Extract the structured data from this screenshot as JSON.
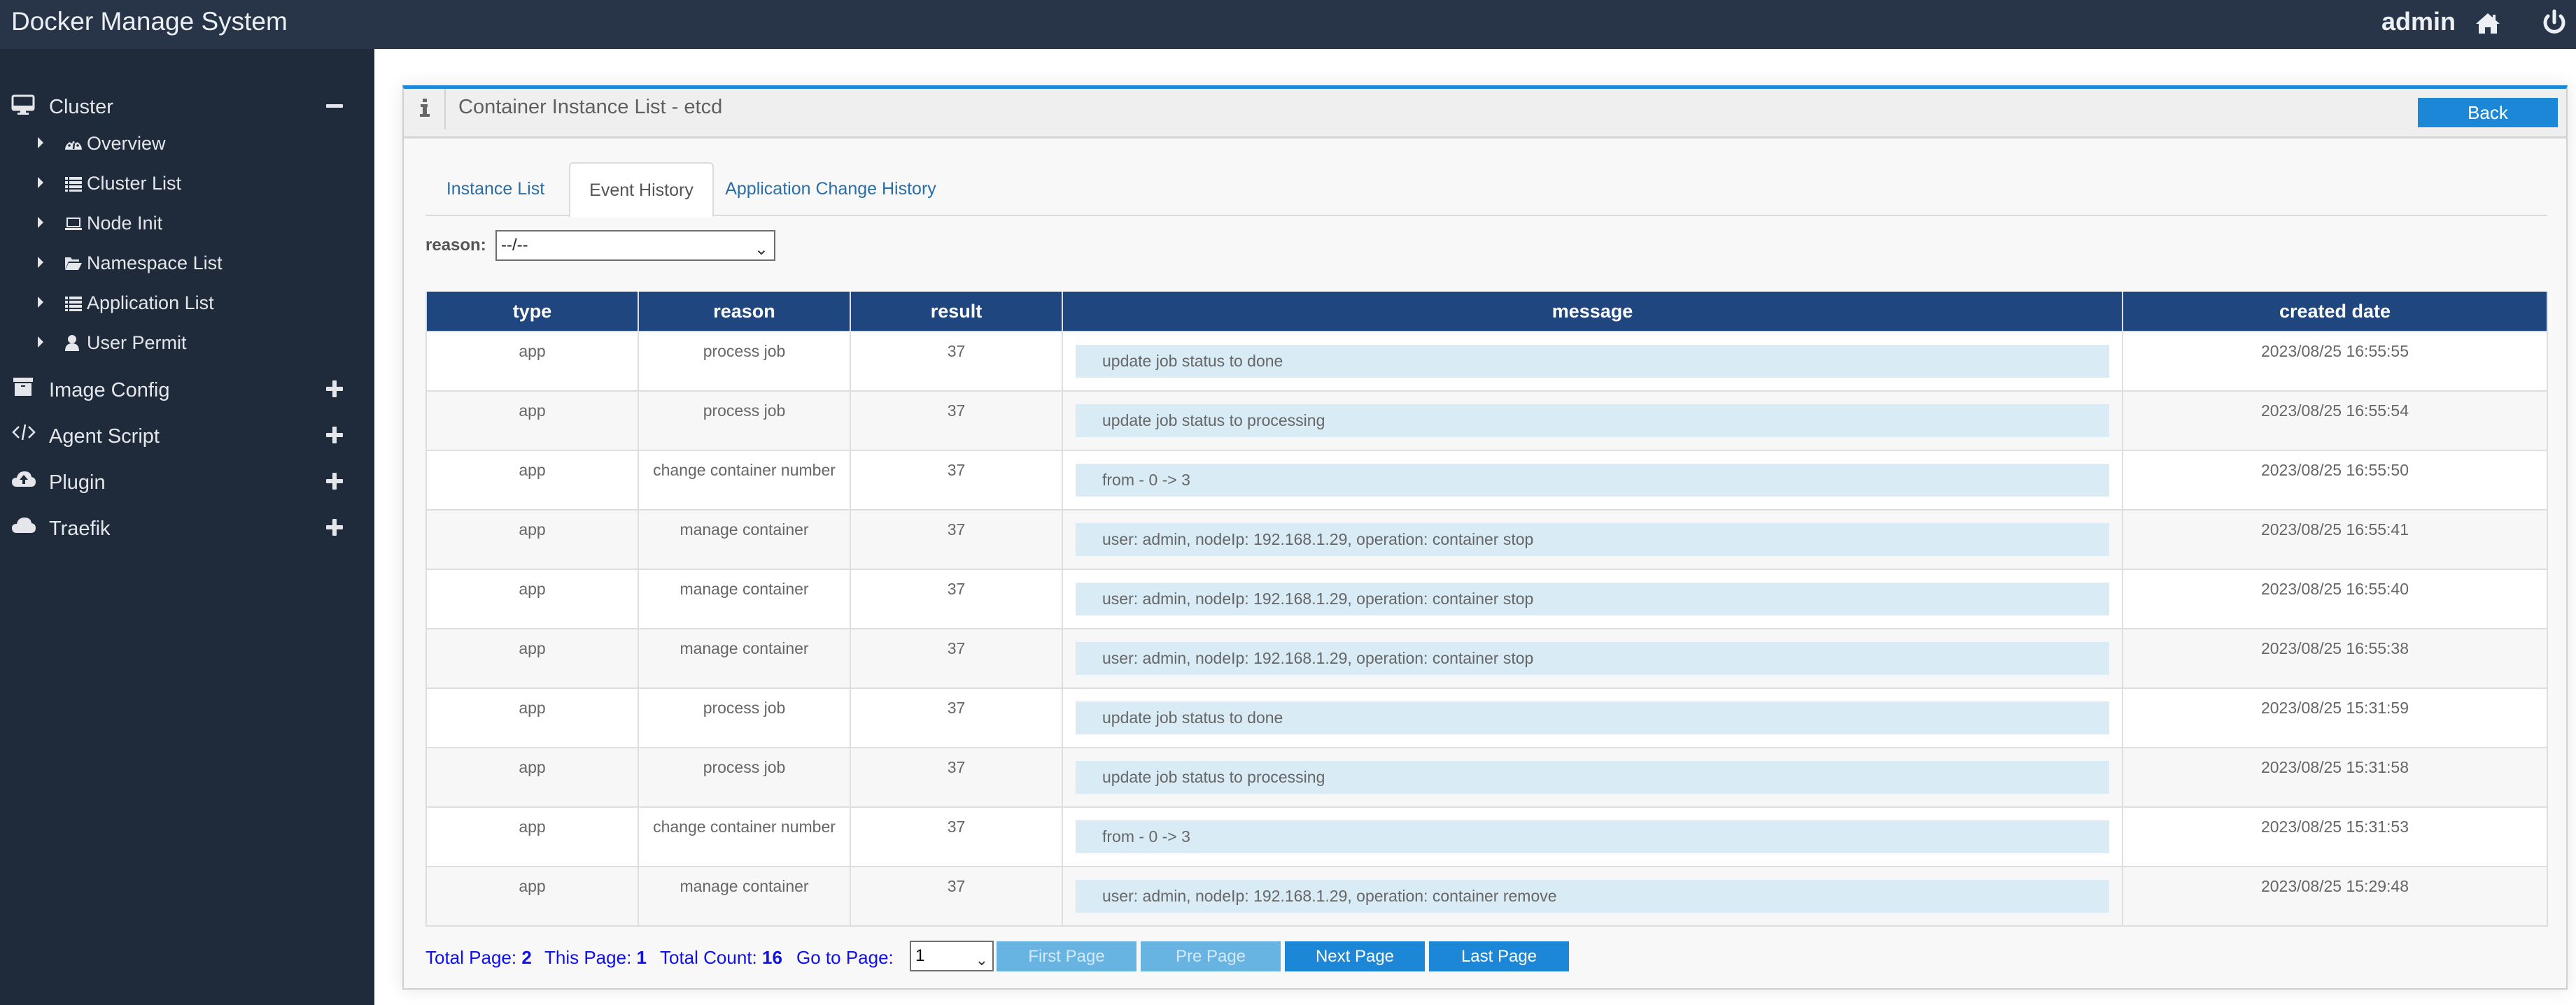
{
  "app": {
    "title": "Docker Manage System",
    "user": "admin"
  },
  "colors": {
    "header_bg": "#283548",
    "sidebar_bg": "#1f2a3b",
    "accent": "#1c87d6",
    "table_header": "#1f467f",
    "message_bg": "#d9ecf6",
    "pager_text": "#1010ee"
  },
  "sidebar": {
    "groups": [
      {
        "label": "Cluster",
        "icon": "desktop-icon",
        "expanded": true,
        "items": [
          {
            "label": "Overview",
            "icon": "dashboard-icon"
          },
          {
            "label": "Cluster List",
            "icon": "list-icon"
          },
          {
            "label": "Node Init",
            "icon": "laptop-icon"
          },
          {
            "label": "Namespace List",
            "icon": "folder-open-icon"
          },
          {
            "label": "Application List",
            "icon": "list-icon"
          },
          {
            "label": "User Permit",
            "icon": "user-icon"
          }
        ]
      },
      {
        "label": "Image Config",
        "icon": "archive-icon",
        "expanded": false
      },
      {
        "label": "Agent Script",
        "icon": "code-icon",
        "expanded": false
      },
      {
        "label": "Plugin",
        "icon": "cloud-upload-icon",
        "expanded": false
      },
      {
        "label": "Traefik",
        "icon": "cloud-icon",
        "expanded": false
      }
    ]
  },
  "panel": {
    "title": "Container Instance List - etcd",
    "back_label": "Back"
  },
  "tabs": [
    {
      "label": "Instance List",
      "active": false
    },
    {
      "label": "Event History",
      "active": true
    },
    {
      "label": "Application Change History",
      "active": false
    }
  ],
  "filter": {
    "label": "reason:",
    "selected": "--/--"
  },
  "table": {
    "columns": [
      "type",
      "reason",
      "result",
      "message",
      "created date"
    ],
    "rows": [
      {
        "type": "app",
        "reason": "process job",
        "result": "37",
        "message": "update job status to done",
        "created": "2023/08/25 16:55:55"
      },
      {
        "type": "app",
        "reason": "process job",
        "result": "37",
        "message": "update job status to processing",
        "created": "2023/08/25 16:55:54"
      },
      {
        "type": "app",
        "reason": "change container number",
        "result": "37",
        "message": "from - 0 -> 3",
        "created": "2023/08/25 16:55:50"
      },
      {
        "type": "app",
        "reason": "manage container",
        "result": "37",
        "message": "user: admin, nodeIp: 192.168.1.29, operation: container stop",
        "created": "2023/08/25 16:55:41"
      },
      {
        "type": "app",
        "reason": "manage container",
        "result": "37",
        "message": "user: admin, nodeIp: 192.168.1.29, operation: container stop",
        "created": "2023/08/25 16:55:40"
      },
      {
        "type": "app",
        "reason": "manage container",
        "result": "37",
        "message": "user: admin, nodeIp: 192.168.1.29, operation: container stop",
        "created": "2023/08/25 16:55:38"
      },
      {
        "type": "app",
        "reason": "process job",
        "result": "37",
        "message": "update job status to done",
        "created": "2023/08/25 15:31:59"
      },
      {
        "type": "app",
        "reason": "process job",
        "result": "37",
        "message": "update job status to processing",
        "created": "2023/08/25 15:31:58"
      },
      {
        "type": "app",
        "reason": "change container number",
        "result": "37",
        "message": "from - 0 -> 3",
        "created": "2023/08/25 15:31:53"
      },
      {
        "type": "app",
        "reason": "manage container",
        "result": "37",
        "message": "user: admin, nodeIp: 192.168.1.29, operation: container remove",
        "created": "2023/08/25 15:29:48"
      }
    ]
  },
  "pager": {
    "total_page_label": "Total Page:",
    "total_page": "2",
    "this_page_label": "This Page:",
    "this_page": "1",
    "total_count_label": "Total Count:",
    "total_count": "16",
    "goto_label": "Go to Page:",
    "goto_selected": "1",
    "first_label": "First Page",
    "pre_label": "Pre Page",
    "next_label": "Next Page",
    "last_label": "Last Page"
  }
}
